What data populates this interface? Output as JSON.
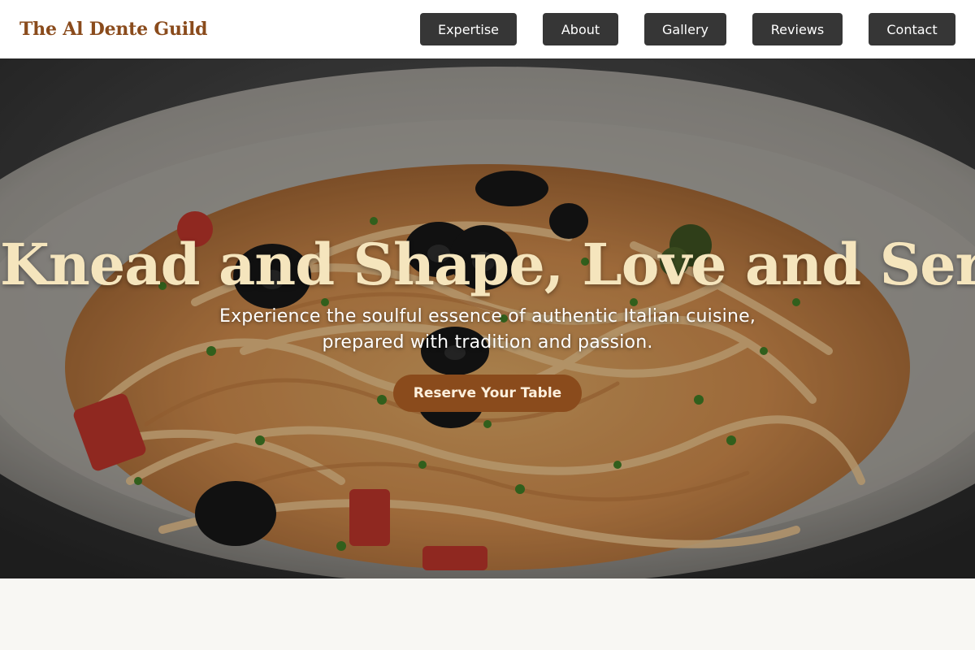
{
  "header": {
    "brand": "The Al Dente Guild",
    "nav": [
      {
        "label": "Expertise"
      },
      {
        "label": "About"
      },
      {
        "label": "Gallery"
      },
      {
        "label": "Reviews"
      },
      {
        "label": "Contact"
      }
    ]
  },
  "hero": {
    "title": "Knead and Shape, Love and Serve.",
    "subtitle": "Experience the soulful essence of authentic Italian cuisine, prepared with tradition and passion.",
    "cta_label": "Reserve Your Table",
    "image_icon": "pasta-plate-photo"
  },
  "colors": {
    "brand": "#8a4b1c",
    "nav_bg": "#363636",
    "title": "#f5e5bd",
    "section_bg": "#f8f7f3"
  }
}
